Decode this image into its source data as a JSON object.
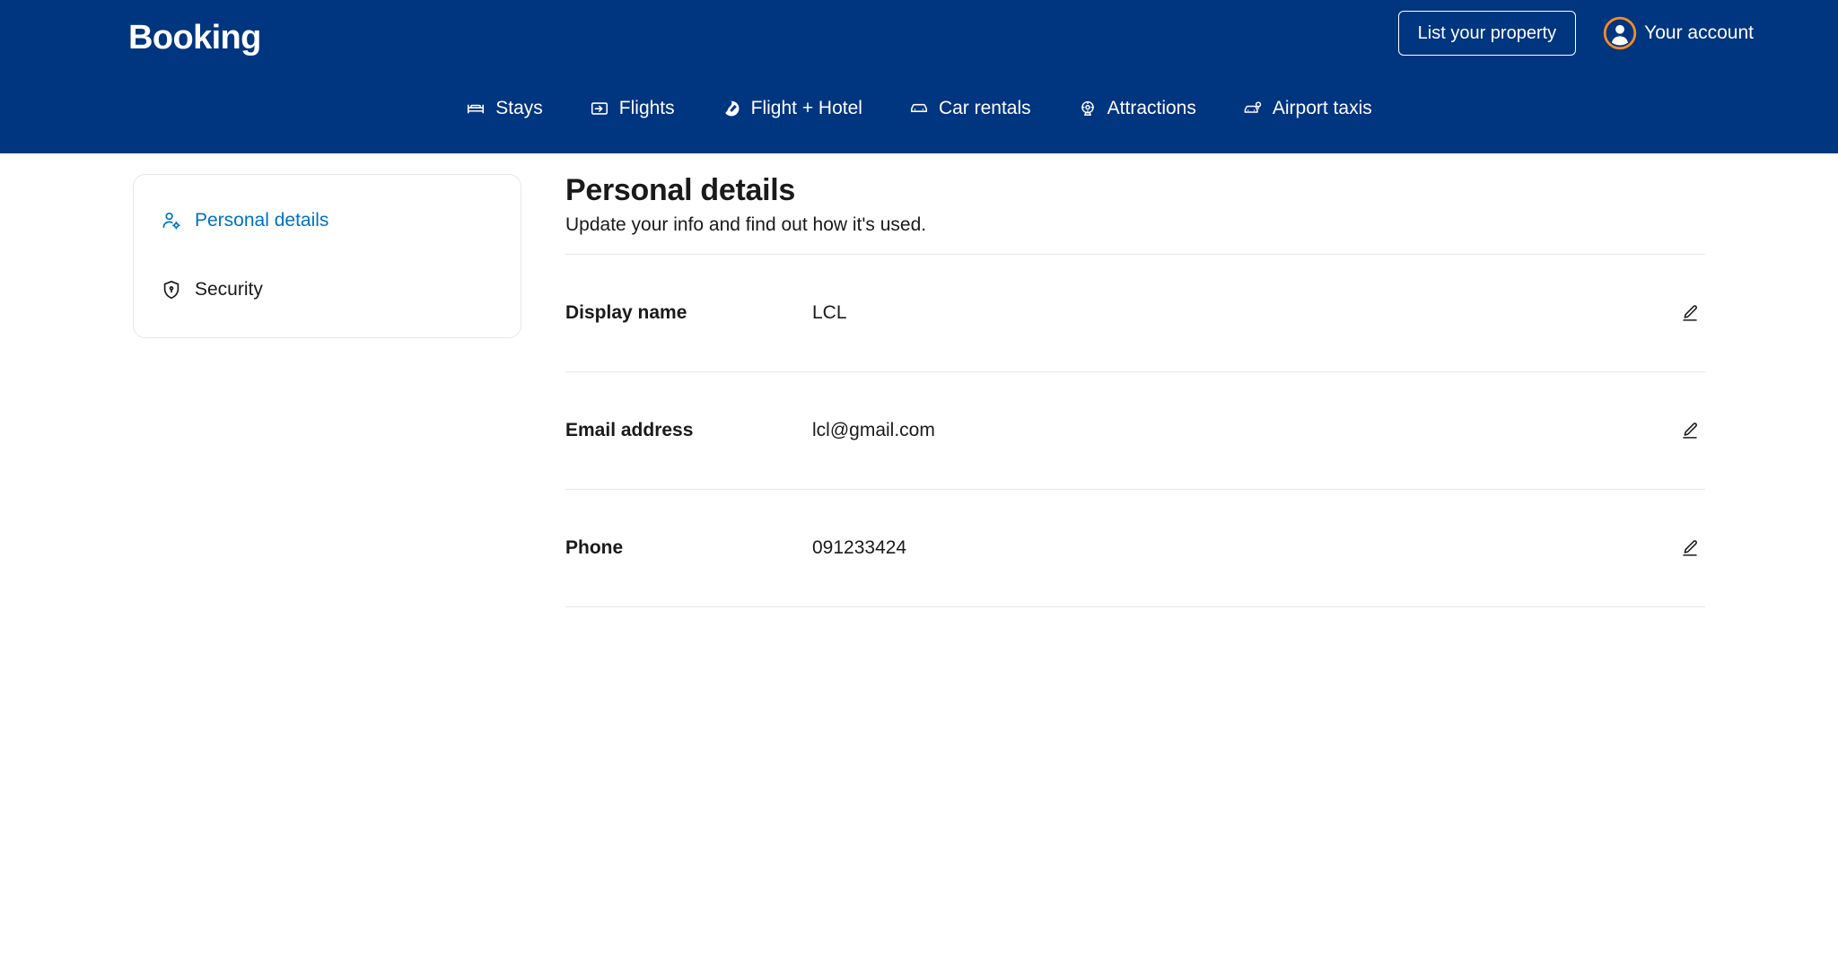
{
  "header": {
    "brand": "Booking",
    "list_property_label": "List your property",
    "account_label": "Your account",
    "account_icon": "user-avatar-icon",
    "brand_color": "#003580",
    "accent_color": "#0071c2",
    "avatar_ring_color": "#f28c28",
    "nav": [
      {
        "label": "Stays",
        "icon": "bed-icon"
      },
      {
        "label": "Flights",
        "icon": "plane-ticket-icon"
      },
      {
        "label": "Flight + Hotel",
        "icon": "globe-plane-icon"
      },
      {
        "label": "Car rentals",
        "icon": "car-icon"
      },
      {
        "label": "Attractions",
        "icon": "ferris-wheel-icon"
      },
      {
        "label": "Airport taxis",
        "icon": "taxi-icon"
      }
    ]
  },
  "sidebar": {
    "items": [
      {
        "label": "Personal details",
        "icon": "person-gear-icon",
        "active": true
      },
      {
        "label": "Security",
        "icon": "shield-keyhole-icon",
        "active": false
      }
    ]
  },
  "main": {
    "title": "Personal details",
    "subtitle": "Update your info and find out how it's used.",
    "rows": [
      {
        "label": "Display name",
        "value": "LCL",
        "edit_icon": "pencil-edit-icon"
      },
      {
        "label": "Email address",
        "value": "lcl@gmail.com",
        "edit_icon": "pencil-edit-icon"
      },
      {
        "label": "Phone",
        "value": "091233424",
        "edit_icon": "pencil-edit-icon"
      }
    ]
  }
}
